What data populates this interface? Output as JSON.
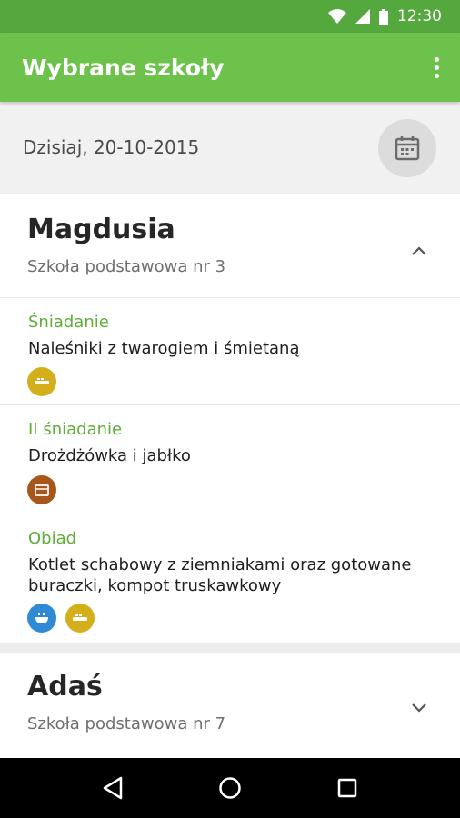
{
  "status_bar": {
    "time": "12:30",
    "icons": [
      "wifi-icon",
      "signal-icon",
      "battery-icon"
    ]
  },
  "app_bar": {
    "title": "Wybrane szkoły",
    "menu_icon": "overflow-menu-icon"
  },
  "date_row": {
    "label": "Dzisiaj, 20-10-2015",
    "button_icon": "calendar-icon"
  },
  "children": [
    {
      "name": "Magdusia",
      "school": "Szkoła podstawowa nr 3",
      "expanded": true,
      "meals": [
        {
          "name": "Śniadanie",
          "description": "Naleśniki z twarogiem i śmietaną",
          "icons": [
            {
              "name": "dairy-icon",
              "color": "#d4af1c"
            }
          ]
        },
        {
          "name": "II śniadanie",
          "description": "Drożdżówka i jabłko",
          "icons": [
            {
              "name": "bakery-icon",
              "color": "#a8561a"
            }
          ]
        },
        {
          "name": "Obiad",
          "description": "Kotlet schabowy z ziemniakami oraz gotowane buraczki, kompot truskawkowy",
          "icons": [
            {
              "name": "soup-icon",
              "color": "#2f8ad6"
            },
            {
              "name": "dairy-icon",
              "color": "#d4af1c"
            }
          ]
        }
      ]
    },
    {
      "name": "Adaś",
      "school": "Szkoła podstawowa nr 7",
      "expanded": false
    }
  ],
  "nav_bar": {
    "buttons": [
      "back-icon",
      "home-icon",
      "recents-icon"
    ]
  },
  "colors": {
    "primary": "#6cc24a",
    "primary_dark": "#55a83e",
    "accent_text": "#5fae3a"
  }
}
